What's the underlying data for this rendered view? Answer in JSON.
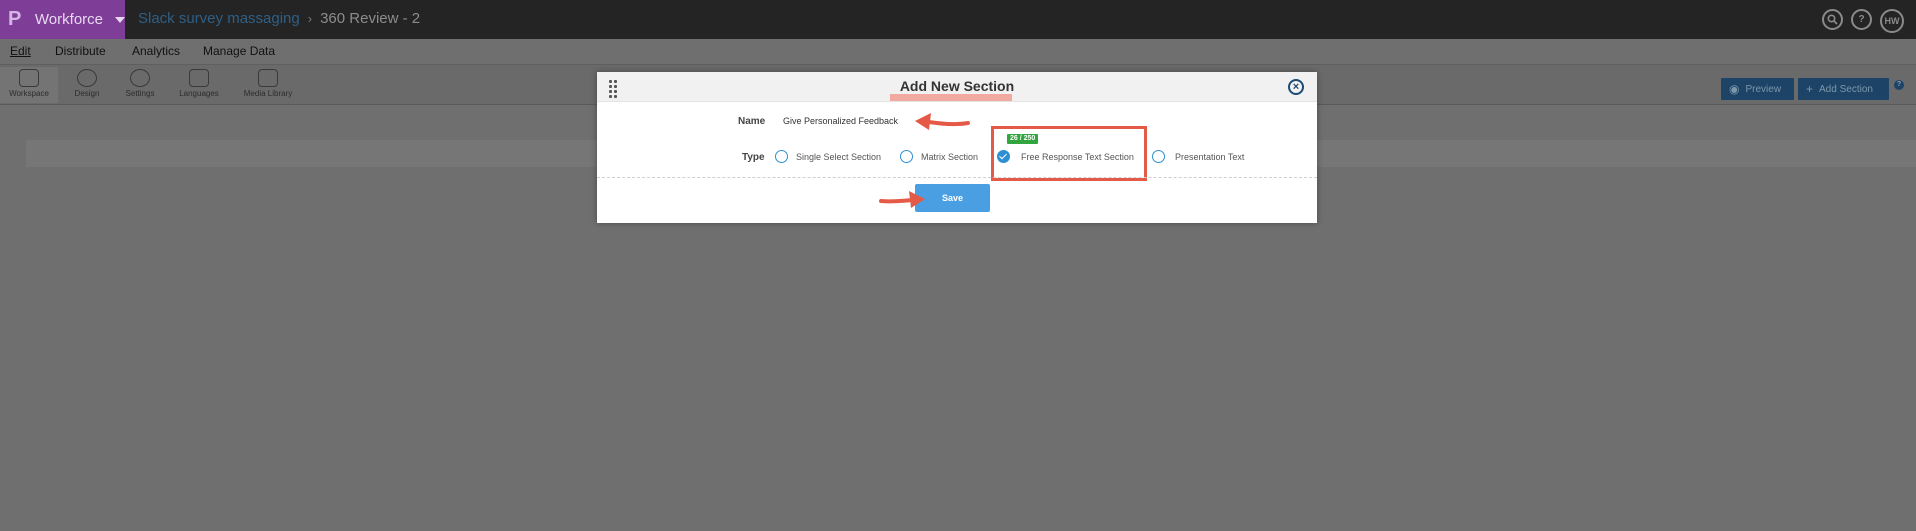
{
  "app": {
    "name": "Workforce",
    "logo_glyph": "P",
    "accent": "#7e3e98"
  },
  "breadcrumb": {
    "project": "Slack survey massaging",
    "separator": "›",
    "survey": "360 Review - 2"
  },
  "top_icons": {
    "search": "search-icon",
    "help": "?",
    "avatar": "HW"
  },
  "menu": [
    "Edit",
    "Distribute",
    "Analytics",
    "Manage Data"
  ],
  "toolbar": {
    "tools": [
      "Workspace",
      "Design",
      "Settings",
      "Languages",
      "Media Library"
    ],
    "preview_label": "Preview",
    "add_section_label": "Add Section",
    "help": "?"
  },
  "modal": {
    "title": "Add New Section",
    "close": "×",
    "name_label": "Name",
    "name_value": "Give Personalized Feedback",
    "type_label": "Type",
    "char_counter": "26 / 250",
    "types": [
      {
        "label": "Single Select Section",
        "selected": false
      },
      {
        "label": "Matrix Section",
        "selected": false
      },
      {
        "label": "Free Response Text Section",
        "selected": true
      },
      {
        "label": "Presentation Text",
        "selected": false
      }
    ],
    "save_label": "Save"
  },
  "colors": {
    "annotation": "#e45a46",
    "primary_button": "#4a9fe3",
    "radio": "#2f8fd0",
    "counter_badge": "#32a63e"
  }
}
